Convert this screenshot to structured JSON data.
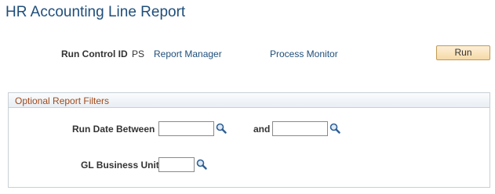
{
  "page": {
    "title": "HR Accounting Line Report"
  },
  "run_control": {
    "label": "Run Control ID",
    "value": "PS",
    "report_manager_link": "Report Manager",
    "process_monitor_link": "Process Monitor",
    "run_button": "Run"
  },
  "filters": {
    "title": "Optional Report Filters",
    "run_date_label": "Run Date Between",
    "and_label": "and",
    "run_date_from": "",
    "run_date_to": "",
    "gl_business_unit_label": "GL Business Unit",
    "gl_business_unit": ""
  },
  "icons": {
    "lookup": "magnifier-lookup-icon"
  },
  "colors": {
    "title": "#1f4e7a",
    "link": "#1f4e7a",
    "section_title": "#a04a1c",
    "button_fill": "#f6d9a6"
  }
}
